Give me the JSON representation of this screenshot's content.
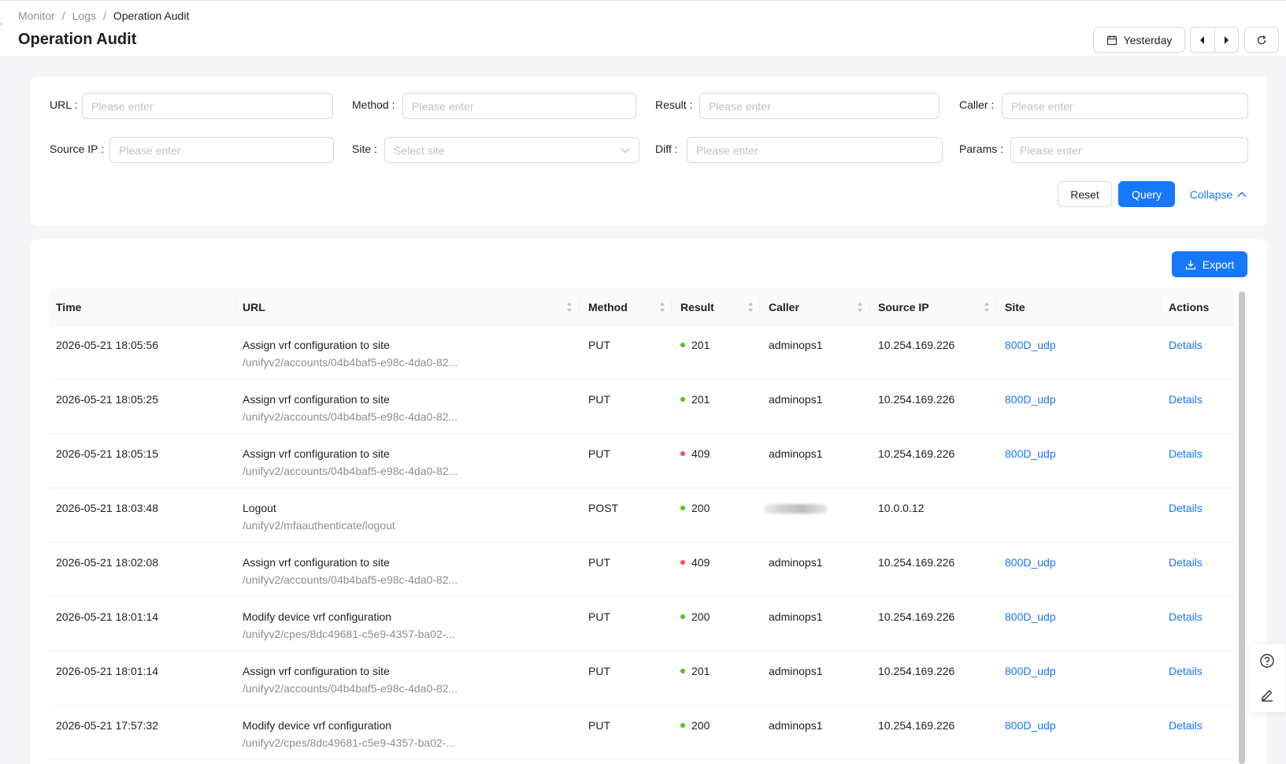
{
  "breadcrumb": [
    "Monitor",
    "Logs",
    "Operation Audit"
  ],
  "page": {
    "title": "Operation Audit"
  },
  "header_actions": {
    "date_range": "Yesterday"
  },
  "filters": {
    "url": {
      "label": "URL",
      "placeholder": "Please enter"
    },
    "method": {
      "label": "Method",
      "placeholder": "Please enter"
    },
    "result": {
      "label": "Result",
      "placeholder": "Please enter"
    },
    "caller": {
      "label": "Caller",
      "placeholder": "Please enter"
    },
    "source_ip": {
      "label": "Source IP",
      "placeholder": "Please enter"
    },
    "site": {
      "label": "Site",
      "placeholder": "Select site"
    },
    "diff": {
      "label": "Diff",
      "placeholder": "Please enter"
    },
    "params": {
      "label": "Params",
      "placeholder": "Please enter"
    },
    "reset_label": "Reset",
    "query_label": "Query",
    "collapse_label": "Collapse"
  },
  "toolbar": {
    "export_label": "Export"
  },
  "table": {
    "columns": [
      "Time",
      "URL",
      "Method",
      "Result",
      "Caller",
      "Source IP",
      "Site",
      "Actions"
    ],
    "rows": [
      {
        "time": "2026-05-21 18:05:56",
        "url_title": "Assign vrf configuration to site",
        "url_path": "/unifyv2/accounts/04b4baf5-e98c-4da0-82...",
        "method": "PUT",
        "result": "201",
        "status": "success",
        "caller": "adminops1",
        "source_ip": "10.254.169.226",
        "site": "800D_udp",
        "action": "Details"
      },
      {
        "time": "2026-05-21 18:05:25",
        "url_title": "Assign vrf configuration to site",
        "url_path": "/unifyv2/accounts/04b4baf5-e98c-4da0-82...",
        "method": "PUT",
        "result": "201",
        "status": "success",
        "caller": "adminops1",
        "source_ip": "10.254.169.226",
        "site": "800D_udp",
        "action": "Details"
      },
      {
        "time": "2026-05-21 18:05:15",
        "url_title": "Assign vrf configuration to site",
        "url_path": "/unifyv2/accounts/04b4baf5-e98c-4da0-82...",
        "method": "PUT",
        "result": "409",
        "status": "error",
        "caller": "adminops1",
        "source_ip": "10.254.169.226",
        "site": "800D_udp",
        "action": "Details"
      },
      {
        "time": "2026-05-21 18:03:48",
        "url_title": "Logout",
        "url_path": "/unifyv2/mfaauthenticate/logout",
        "method": "POST",
        "result": "200",
        "status": "success",
        "caller": "",
        "caller_redacted": true,
        "source_ip": "10.0.0.12",
        "site": "",
        "action": "Details"
      },
      {
        "time": "2026-05-21 18:02:08",
        "url_title": "Assign vrf configuration to site",
        "url_path": "/unifyv2/accounts/04b4baf5-e98c-4da0-82...",
        "method": "PUT",
        "result": "409",
        "status": "error",
        "caller": "adminops1",
        "source_ip": "10.254.169.226",
        "site": "800D_udp",
        "action": "Details"
      },
      {
        "time": "2026-05-21 18:01:14",
        "url_title": "Modify device vrf configuration",
        "url_path": "/unifyv2/cpes/8dc49681-c5e9-4357-ba02-...",
        "method": "PUT",
        "result": "200",
        "status": "success",
        "caller": "adminops1",
        "source_ip": "10.254.169.226",
        "site": "800D_udp",
        "action": "Details"
      },
      {
        "time": "2026-05-21 18:01:14",
        "url_title": "Assign vrf configuration to site",
        "url_path": "/unifyv2/accounts/04b4baf5-e98c-4da0-82...",
        "method": "PUT",
        "result": "201",
        "status": "success",
        "caller": "adminops1",
        "source_ip": "10.254.169.226",
        "site": "800D_udp",
        "action": "Details"
      },
      {
        "time": "2026-05-21 17:57:32",
        "url_title": "Modify device vrf configuration",
        "url_path": "/unifyv2/cpes/8dc49681-c5e9-4357-ba02-...",
        "method": "PUT",
        "result": "200",
        "status": "success",
        "caller": "adminops1",
        "source_ip": "10.254.169.226",
        "site": "800D_udp",
        "action": "Details"
      }
    ]
  },
  "colors": {
    "primary": "#1677ff",
    "success": "#52c41a",
    "error": "#ff4d4f"
  },
  "icons": {
    "date": "calendar-icon",
    "prev": "caret-left-icon",
    "next": "caret-right-icon",
    "refresh": "reload-icon",
    "collapse": "chevron-up-icon",
    "export": "download-icon",
    "select": "chevron-down-icon",
    "help": "question-circle-icon",
    "feedback": "edit-icon"
  }
}
